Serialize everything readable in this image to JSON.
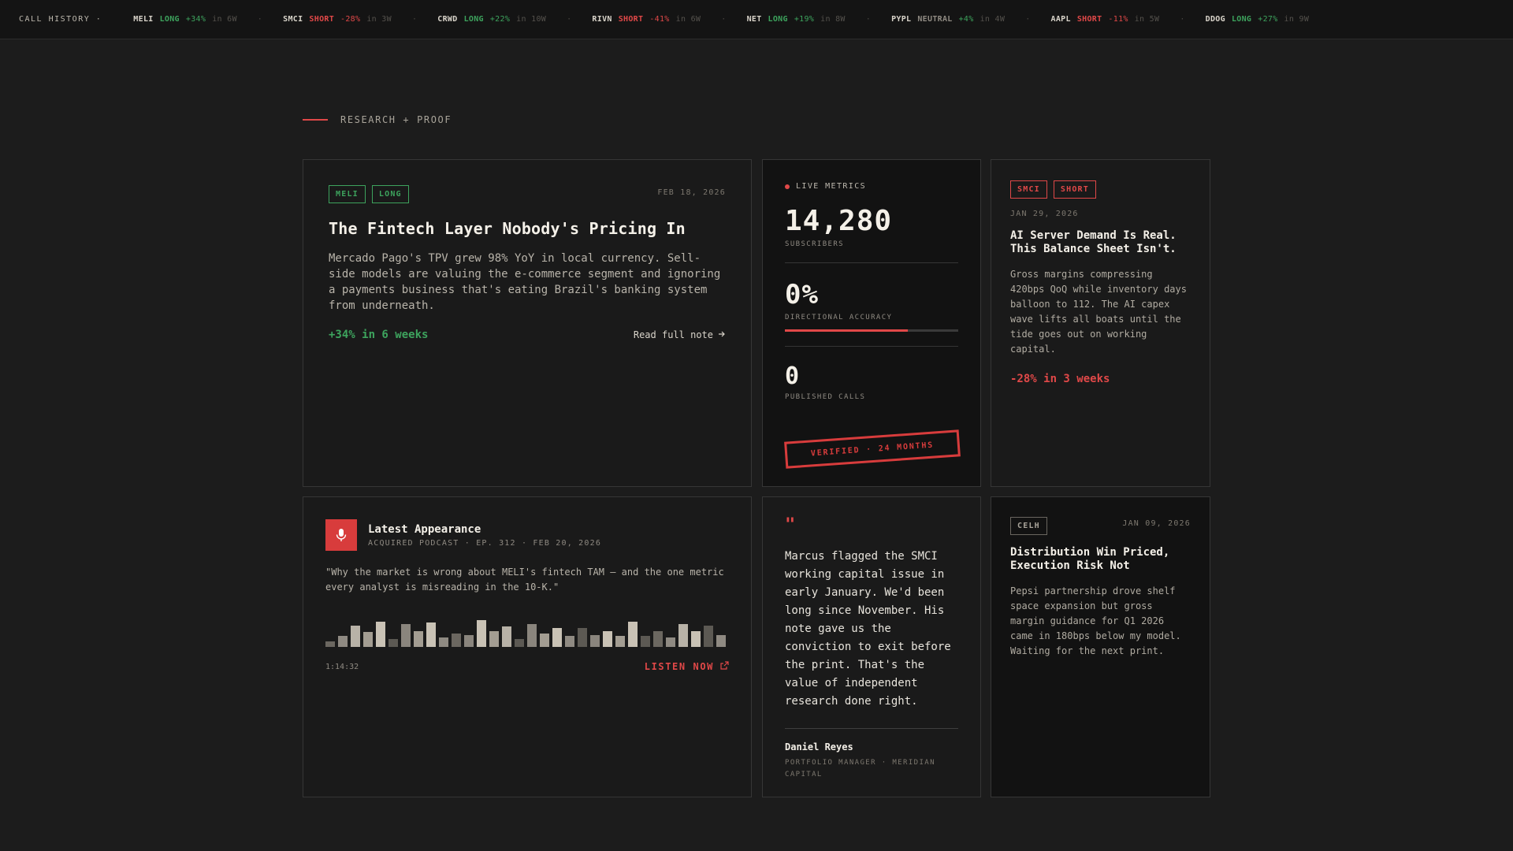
{
  "ticker": {
    "label": "CALL HISTORY ·",
    "items": [
      {
        "sym": "MELI",
        "dir": "LONG",
        "cls": "long",
        "chg": "+34%",
        "chgcls": "pos",
        "dur": "in 6W"
      },
      {
        "sym": "SMCI",
        "dir": "SHORT",
        "cls": "short",
        "chg": "-28%",
        "chgcls": "neg",
        "dur": "in 3W"
      },
      {
        "sym": "CRWD",
        "dir": "LONG",
        "cls": "long",
        "chg": "+22%",
        "chgcls": "pos",
        "dur": "in 10W"
      },
      {
        "sym": "RIVN",
        "dir": "SHORT",
        "cls": "short",
        "chg": "-41%",
        "chgcls": "neg",
        "dur": "in 6W"
      },
      {
        "sym": "NET",
        "dir": "LONG",
        "cls": "long",
        "chg": "+19%",
        "chgcls": "pos",
        "dur": "in 8W"
      },
      {
        "sym": "PYPL",
        "dir": "NEUTRAL",
        "cls": "neutral",
        "chg": "+4%",
        "chgcls": "pos",
        "dur": "in 4W"
      },
      {
        "sym": "AAPL",
        "dir": "SHORT",
        "cls": "short",
        "chg": "-11%",
        "chgcls": "neg",
        "dur": "in 5W"
      },
      {
        "sym": "DDOG",
        "dir": "LONG",
        "cls": "long",
        "chg": "+27%",
        "chgcls": "pos",
        "dur": "in 9W"
      }
    ]
  },
  "section": {
    "title": "RESEARCH + PROOF"
  },
  "note1": {
    "tags": [
      "MELI",
      "LONG"
    ],
    "date": "FEB 18, 2026",
    "title": "The Fintech Layer Nobody's Pricing In",
    "body": "Mercado Pago's TPV grew 98% YoY in local currency. Sell-side models are valuing the e-commerce segment and ignoring a payments business that's eating Brazil's banking system from underneath.",
    "perf": "+34% in 6 weeks",
    "link": "Read full note"
  },
  "metrics": {
    "live_label": "LIVE METRICS",
    "subscribers_value": "14,280",
    "subscribers_label": "SUBSCRIBERS",
    "accuracy_value": "0%",
    "accuracy_label": "DIRECTIONAL ACCURACY",
    "accuracy_bar_fraction": 0.71,
    "calls_value": "0",
    "calls_label": "PUBLISHED CALLS",
    "stamp": "VERIFIED · 24 MONTHS"
  },
  "note2": {
    "tags": [
      "SMCI",
      "SHORT"
    ],
    "date": "JAN 29, 2026",
    "title": "AI Server Demand Is Real. This Balance Sheet Isn't.",
    "body": "Gross margins compressing 420bps QoQ while inventory days balloon to 112. The AI capex wave lifts all boats until the tide goes out on working capital.",
    "perf": "-28% in 3 weeks"
  },
  "podcast": {
    "title": "Latest Appearance",
    "meta": "ACQUIRED PODCAST · EP. 312 · FEB 20, 2026",
    "quote": "\"Why the market is wrong about MELI's fintech TAM — and the one metric every analyst is misreading in the 10-K.\"",
    "duration": "1:14:32",
    "listen": "LISTEN NOW",
    "wave_levels": [
      0.2,
      0.4,
      0.8,
      0.55,
      0.95,
      0.3,
      0.85,
      0.6,
      0.9,
      0.35,
      0.5,
      0.45,
      1.0,
      0.6,
      0.75,
      0.3,
      0.85,
      0.5,
      0.7,
      0.4,
      0.7,
      0.45,
      0.6,
      0.4,
      0.95,
      0.4,
      0.6,
      0.35,
      0.85,
      0.6,
      0.8,
      0.45
    ],
    "wave_shades": [
      "#6b6760",
      "#8f8a82",
      "#b8b2a7",
      "#a39d92",
      "#c9c2b5",
      "#5c5953",
      "#8a857d",
      "#a39d92",
      "#c9c2b5",
      "#8f8a82",
      "#6b6760",
      "#8a857d",
      "#c9c2b5",
      "#a39d92",
      "#b8b2a7",
      "#5c5953",
      "#8a857d",
      "#a39d92",
      "#c9c2b5",
      "#8f8a82",
      "#5c5953",
      "#8a857d",
      "#c9c2b5",
      "#a39d92",
      "#c9c2b5",
      "#5c5953",
      "#6b6760",
      "#8f8a82",
      "#b8b2a7",
      "#c9c2b5",
      "#5c5953",
      "#8f8a82"
    ]
  },
  "testimonial": {
    "mark": "\"",
    "quote": "Marcus flagged the SMCI working capital issue in early January. We'd been long since November. His note gave us the conviction to exit before the print. That's the value of independent research done right.",
    "name": "Daniel Reyes",
    "role": "PORTFOLIO MANAGER · MERIDIAN CAPITAL"
  },
  "note3": {
    "tags": [
      "CELH"
    ],
    "date": "JAN 09, 2026",
    "title": "Distribution Win Priced, Execution Risk Not",
    "body": "Pepsi partnership drove shelf space expansion but gross margin guidance for Q1 2026 came in 180bps below my model. Waiting for the next print."
  }
}
